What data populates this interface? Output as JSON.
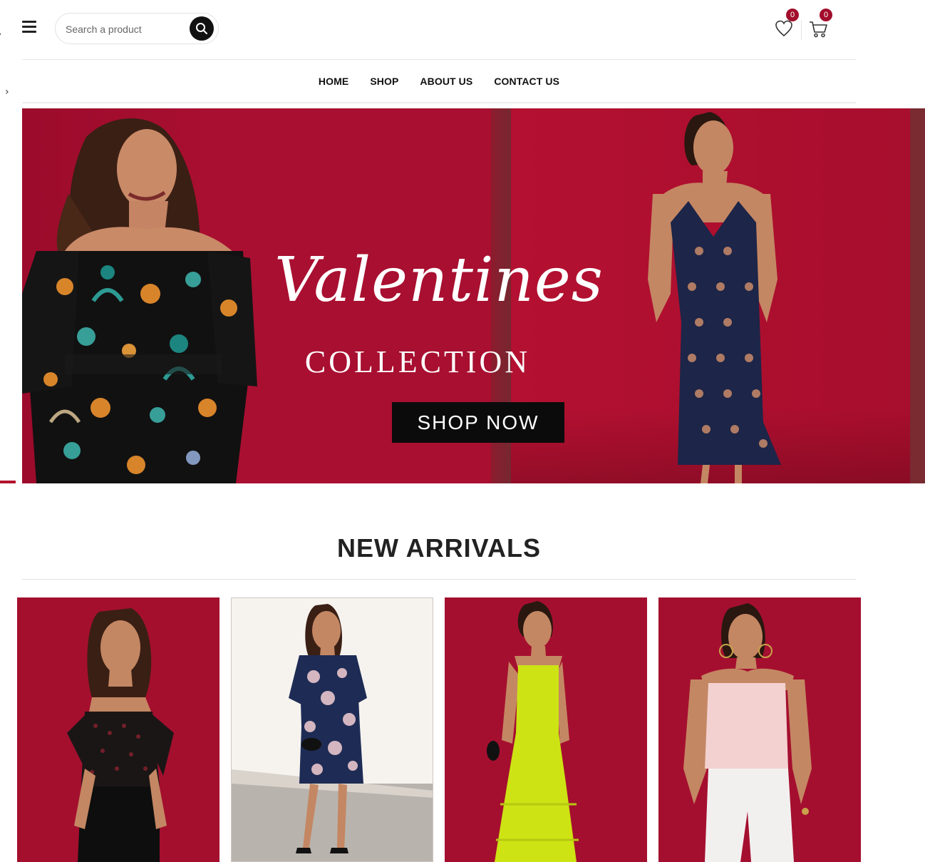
{
  "header": {
    "search": {
      "placeholder": "Search a product"
    },
    "wishlist": {
      "icon": "heart-icon",
      "count": "0"
    },
    "cart": {
      "icon": "cart-icon",
      "count": "0"
    },
    "menu_icon": "hamburger-icon"
  },
  "nav": {
    "items": [
      {
        "label": "HOME"
      },
      {
        "label": "SHOP"
      },
      {
        "label": "ABOUT US"
      },
      {
        "label": "CONTACT US"
      }
    ]
  },
  "hero": {
    "script_title": "Valentines",
    "subtitle": "COLLECTION",
    "cta": "SHOP NOW"
  },
  "new_arrivals": {
    "title_light": "NEW",
    "title_bold": "ARRIVALS"
  },
  "colors": {
    "brand_red": "#a30d2e",
    "badge": "#a20d2b",
    "dark": "#111111"
  }
}
